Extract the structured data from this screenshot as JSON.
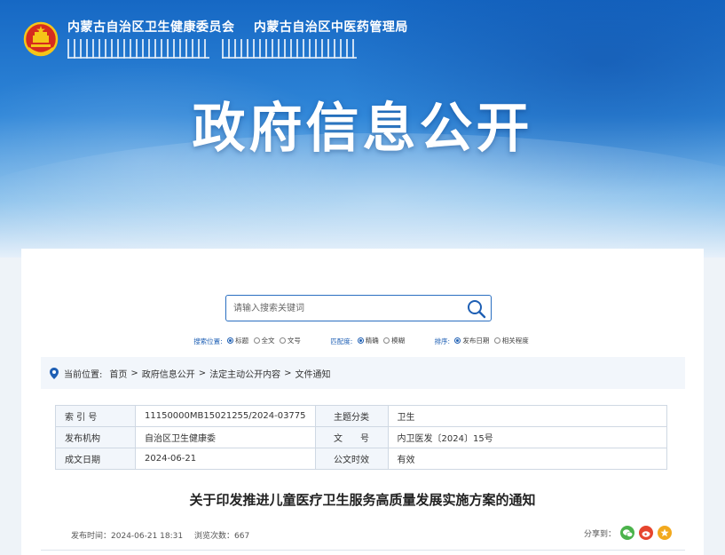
{
  "header": {
    "org1": "内蒙古自治区卫生健康委员会",
    "org2": "内蒙古自治区中医药管理局",
    "banner_title": "政府信息公开"
  },
  "search": {
    "placeholder": "请输入搜索关键词",
    "filters": [
      {
        "label": "搜索位置:",
        "options": [
          {
            "text": "标题",
            "selected": true
          },
          {
            "text": "全文",
            "selected": false
          },
          {
            "text": "文号",
            "selected": false
          }
        ]
      },
      {
        "label": "匹配度:",
        "options": [
          {
            "text": "精确",
            "selected": true
          },
          {
            "text": "模糊",
            "selected": false
          }
        ]
      },
      {
        "label": "排序:",
        "options": [
          {
            "text": "发布日期",
            "selected": true
          },
          {
            "text": "相关程度",
            "selected": false
          }
        ]
      }
    ]
  },
  "breadcrumb": {
    "label": "当前位置:",
    "items": [
      "首页",
      "政府信息公开",
      "法定主动公开内容",
      "文件通知"
    ],
    "separator": ">"
  },
  "meta": {
    "rows": [
      {
        "k1": "索 引 号",
        "v1": "11150000MB15021255/2024-03775",
        "k2": "主题分类",
        "v2": "卫生"
      },
      {
        "k1": "发布机构",
        "v1": "自治区卫生健康委",
        "k2": "文　　号",
        "v2": "内卫医发〔2024〕15号"
      },
      {
        "k1": "成文日期",
        "v1": "2024-06-21",
        "k2": "公文时效",
        "v2": "有效"
      }
    ]
  },
  "article": {
    "title": "关于印发推进儿童医疗卫生服务高质量发展实施方案的通知",
    "publish_label": "发布时间：",
    "publish_time": "2024-06-21 18:31",
    "views_label": "浏览次数：",
    "views": "667",
    "share_label": "分享到："
  },
  "colors": {
    "primary": "#1e5fb4",
    "banner_top": "#1668c4",
    "wechat": "#4bb34b",
    "weibo": "#e6452e",
    "favorite": "#f2a91d"
  },
  "icons": [
    "national-emblem-icon",
    "search-icon",
    "location-pin-icon",
    "wechat-icon",
    "weibo-icon",
    "favorite-icon"
  ]
}
